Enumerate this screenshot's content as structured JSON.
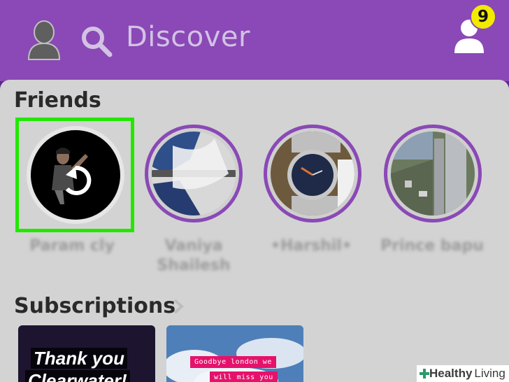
{
  "header": {
    "title": "Discover",
    "notification_count": "9",
    "icons": [
      "user-silhouette-icon",
      "search-icon",
      "add-friend-icon"
    ]
  },
  "friends": {
    "section_title": "Friends",
    "items": [
      {
        "name": "Param cly",
        "state": "viewed-replay",
        "selected": true
      },
      {
        "name": "Vaniya Shailesh",
        "state": "unviewed"
      },
      {
        "name": "•Harshil•",
        "state": "unviewed"
      },
      {
        "name": "Prince bapu",
        "state": "unviewed"
      }
    ]
  },
  "subscriptions": {
    "section_title": "Subscriptions",
    "cards": [
      {
        "caption_line1": "Thank you",
        "caption_line2": "Clearwater!"
      },
      {
        "caption_line1": "Goodbye london we",
        "caption_line2": "will miss you"
      }
    ]
  },
  "watermark": {
    "word1": "Healthy",
    "word2": "Living"
  },
  "colors": {
    "header": "#8a49b6",
    "story_ring": "#8a49b6",
    "highlight": "#22e800",
    "badge": "#f2ea00",
    "content_bg": "#d3d3d3"
  }
}
